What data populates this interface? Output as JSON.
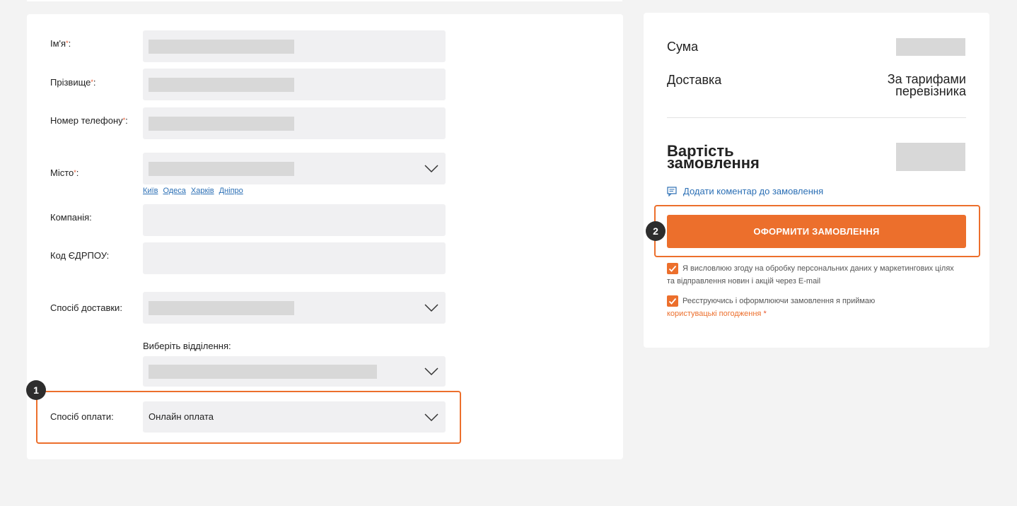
{
  "form": {
    "fields": [
      {
        "label": "Ім'я",
        "required_mark": "*",
        "suffix": ":"
      },
      {
        "label": "Прізвище",
        "required_mark": "*",
        "suffix": ":"
      },
      {
        "label": "Номер телефону",
        "required_mark": "*",
        "suffix": ":"
      },
      {
        "label": "Місто",
        "required_mark": "*",
        "suffix": ":"
      },
      {
        "label": "Компанія:"
      },
      {
        "label": "Код ЄДРПОУ:"
      },
      {
        "label": "Спосіб доставки:"
      }
    ],
    "cities": [
      "Київ",
      "Одеса",
      "Харків",
      "Дніпро"
    ],
    "branch_label": "Виберіть відділення:",
    "payment": {
      "label": "Спосіб оплати:",
      "value": "Онлайн оплата"
    }
  },
  "summary": {
    "sum_label": "Сума",
    "delivery_label": "Доставка",
    "delivery_value_line1": "За тарифами",
    "delivery_value_line2": "перевізника",
    "total_line1": "Вартість",
    "total_line2": "замовлення",
    "comment_link": "Додати коментар до замовлення",
    "order_button": "ОФОРМИТИ ЗАМОВЛЕННЯ",
    "consent1_line1": "Я висловлюю згоду на обробку персональних даних у маркетингових цілях",
    "consent1_line2": "та відправлення новин і акцій через E-mail",
    "consent2_line1": "Реєструючись і оформлюючи замовлення я приймаю",
    "consent2_link": "користувацькі погодження",
    "consent2_required": "*"
  },
  "annotations": {
    "badge1": "1",
    "badge2": "2"
  },
  "colors": {
    "accent": "#ec6f2c",
    "link": "#2b6fb5",
    "field_bg": "#f0f0f2",
    "page_bg": "#f3f3f3"
  }
}
